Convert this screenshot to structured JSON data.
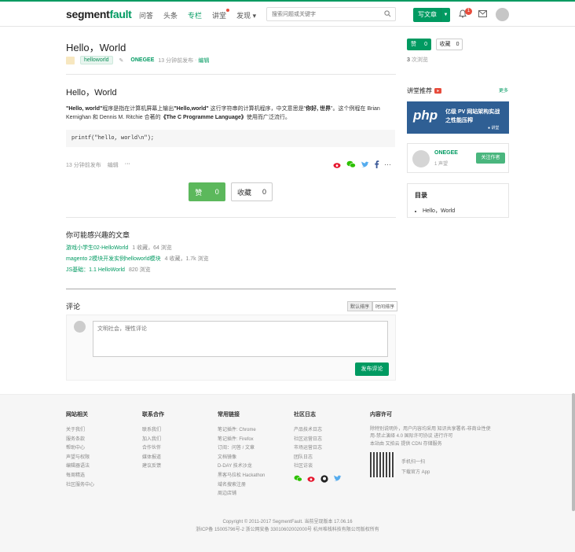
{
  "header": {
    "logo_a": "segment",
    "logo_b": "fault",
    "nav": [
      "问答",
      "头条",
      "专栏",
      "讲堂",
      "发现"
    ],
    "search_placeholder": "搜索问题或关键字",
    "write_label": "写文章",
    "notify_count": "1"
  },
  "article": {
    "title": "Hello，World",
    "tag": "helloworld",
    "author": "ONEGEE",
    "published": "13 分钟前发布",
    "edit": "编辑",
    "like_label": "赞",
    "like_count": "0",
    "fav_label": "收藏",
    "fav_count": "0",
    "views_num": "3",
    "views_label": "次浏览",
    "heading": "Hello，World",
    "para": {
      "p1": "\"Hello, world\"",
      "p2": "程序是指在计算机屏幕上输出",
      "p3": "\"Hello,world\"",
      "p4": " 这行字符串的计算机程序，中文意思是\"",
      "p5": "你好, 世界",
      "p6": "\"。这个例程在 Brian Kernighan 和 Dennis M. Ritchie 合著的",
      "p7": "《The C Programme Language》",
      "p8": "使用而广泛流行。"
    },
    "code": "printf(\"hello, world\\n\");",
    "foot_published": "13 分钟前发布",
    "foot_edit": "编辑",
    "foot_more": "···"
  },
  "interest": {
    "title": "你可能感兴趣的文章",
    "items": [
      {
        "link": "游戏小学生02-HelloWorld",
        "meta": "1 收藏，64 浏览"
      },
      {
        "link": "magento 2模块开发实例helloworld模块",
        "meta": "4 收藏，1.7k 浏览"
      },
      {
        "link": "JS基础：1.1 HelloWorld",
        "meta": "820 浏览"
      }
    ]
  },
  "comments": {
    "title": "评论",
    "sort_default": "默认排序",
    "sort_time": "时间排序",
    "placeholder": "文明社会，理性评论",
    "submit": "发布评论"
  },
  "sidebar": {
    "lecture_title": "讲堂推荐",
    "more": "更多",
    "banner_php": "php",
    "banner_l1": "亿级 PV 网站架构实战",
    "banner_l2": "之性能压榨",
    "banner_l3": "讲堂",
    "author_name": "ONEGEE",
    "author_rep": "1 声望",
    "follow": "关注作者",
    "toc_title": "目录",
    "toc_item": "Hello，World"
  },
  "footer": {
    "cols": [
      {
        "h": "网站相关",
        "items": [
          "关于我们",
          "服务条款",
          "帮助中心",
          "声望与权限",
          "编辑器语法",
          "每周精选",
          "社区服务中心"
        ]
      },
      {
        "h": "联系合作",
        "items": [
          "联系我们",
          "加入我们",
          "合作伙伴",
          "媒体报道",
          "建议反馈"
        ]
      },
      {
        "h": "常用链接",
        "items": [
          "笔记插件: Chrome",
          "笔记插件: Firefox",
          "订阅：问答 / 文章",
          "文档镜像",
          "D-DAY 技术沙龙",
          "黑客马拉松 Hackathon",
          "域名搜索注册",
          "周边店铺"
        ]
      },
      {
        "h": "社区日志",
        "items": [
          "产品技术日志",
          "社区运营日志",
          "市场运营日志",
          "团队日志",
          "社区访谈"
        ]
      }
    ],
    "license_h": "内容许可",
    "license_l1": "除特别说明外，用户内容均采用 知识共享署名-非商业性使",
    "license_l2": "用-禁止演绎 4.0 国际许可协议 进行许可",
    "license_l3": "本站由 又拍云 提供 CDN 存储服务",
    "qr_t1": "手机扫一扫",
    "qr_t2": "下载官方 App",
    "copy1": "Copyright © 2011-2017 SegmentFault. 当前呈现版本 17.06.16",
    "copy2": "浙ICP备 15005796号-2   浙公网安备 33010602002000号   杭州堆栈科技有限公司版权所有"
  },
  "colors": {
    "brand": "#009a61",
    "like": "#5cb85c",
    "banner": "#2f5f94"
  }
}
